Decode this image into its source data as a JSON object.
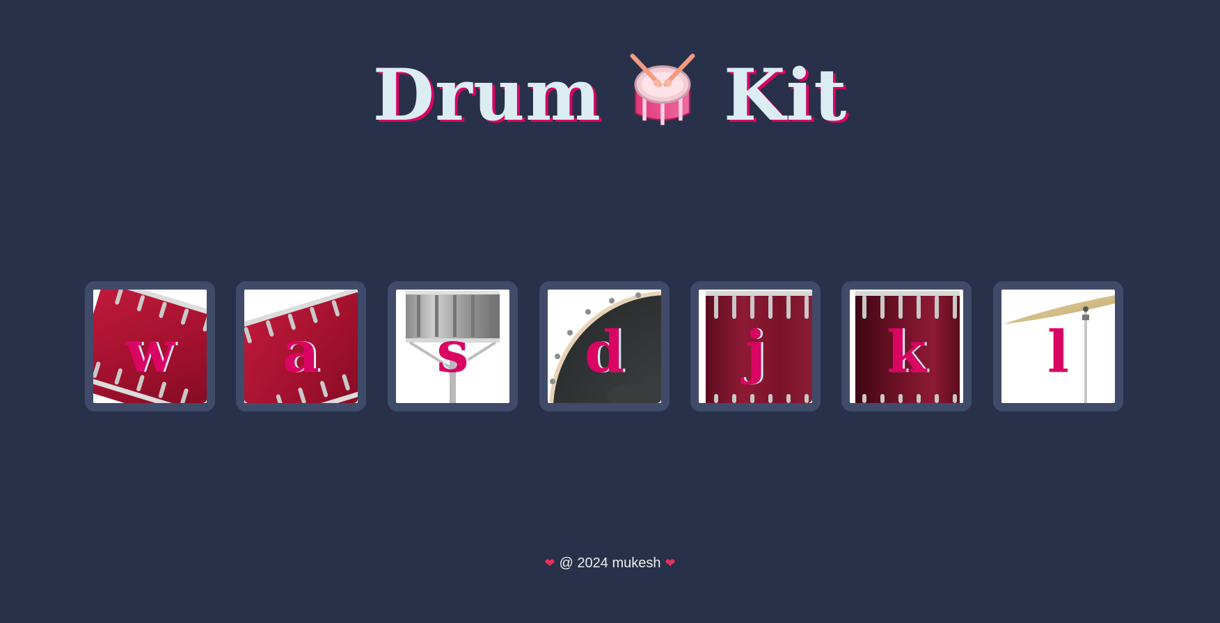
{
  "header": {
    "title_left": "Drum",
    "title_right": "Kit",
    "emoji_icon": "drum-with-sticks-icon"
  },
  "drums": [
    {
      "key": "w",
      "icon": "tom-drum-tilted-icon"
    },
    {
      "key": "a",
      "icon": "tom-drum-tilted-icon"
    },
    {
      "key": "s",
      "icon": "snare-drum-icon"
    },
    {
      "key": "d",
      "icon": "bass-drum-icon"
    },
    {
      "key": "j",
      "icon": "floor-tom-icon"
    },
    {
      "key": "k",
      "icon": "floor-tom-dark-icon"
    },
    {
      "key": "l",
      "icon": "cymbal-icon"
    }
  ],
  "footer": {
    "text": "@ 2024 mukesh",
    "heart_icon": "heart-icon"
  },
  "colors": {
    "background": "#283149",
    "title": "#DBEDF3",
    "accent": "#DA0463",
    "button_border": "#404B69"
  }
}
